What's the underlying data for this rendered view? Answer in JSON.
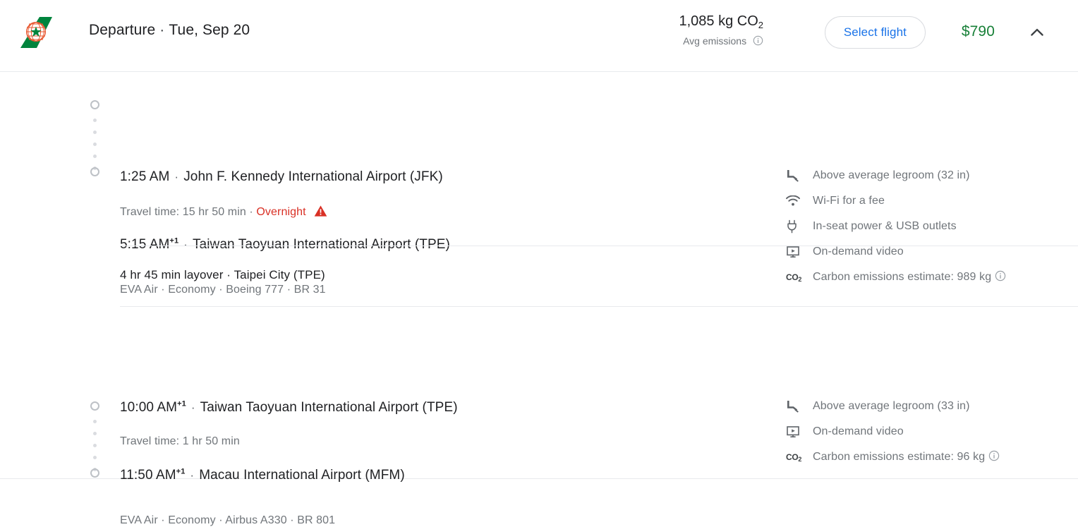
{
  "header": {
    "airline_logo": "eva-air-tail-logo",
    "direction": "Departure",
    "separator": "·",
    "date": "Tue, Sep 20",
    "emissions_value": "1,085 kg CO",
    "emissions_subscript": "2",
    "emissions_label": "Avg emissions",
    "emissions_info_icon": "info-icon",
    "select_flight_label": "Select flight",
    "price": "$790",
    "collapse_icon": "chevron-up-icon"
  },
  "segments": [
    {
      "depart_time": "1:25 AM",
      "depart_day_offset": "",
      "depart_sep": "·",
      "depart_airport": "John F. Kennedy International Airport (JFK)",
      "travel_time": "Travel time: 15 hr 50 min",
      "travel_sep": "·",
      "overnight_label": "Overnight",
      "warning_icon": "warning-triangle-icon",
      "arrive_time": "5:15 AM",
      "arrive_day_offset": "+1",
      "arrive_sep": "·",
      "arrive_airport": "Taiwan Taoyuan International Airport (TPE)",
      "carrier_line": "EVA Air · Economy · Boeing 777 · BR 31",
      "amenities": [
        {
          "icon": "legroom-icon",
          "label": "Above average legroom (32 in)"
        },
        {
          "icon": "wifi-icon",
          "label": "Wi-Fi for a fee"
        },
        {
          "icon": "power-plug-icon",
          "label": "In-seat power & USB outlets"
        },
        {
          "icon": "video-screen-icon",
          "label": "On-demand video"
        },
        {
          "icon": "co2-icon",
          "label": "Carbon emissions estimate: 989 kg",
          "info_icon": "info-icon"
        }
      ]
    },
    {
      "depart_time": "10:00 AM",
      "depart_day_offset": "+1",
      "depart_sep": "·",
      "depart_airport": "Taiwan Taoyuan International Airport (TPE)",
      "travel_time": "Travel time: 1 hr 50 min",
      "travel_sep": "",
      "overnight_label": "",
      "warning_icon": "",
      "arrive_time": "11:50 AM",
      "arrive_day_offset": "+1",
      "arrive_sep": "·",
      "arrive_airport": "Macau International Airport (MFM)",
      "carrier_line": "EVA Air · Economy · Airbus A330 · BR 801",
      "amenities": [
        {
          "icon": "legroom-icon",
          "label": "Above average legroom (33 in)"
        },
        {
          "icon": "video-screen-icon",
          "label": "On-demand video"
        },
        {
          "icon": "co2-icon",
          "label": "Carbon emissions estimate: 96 kg",
          "info_icon": "info-icon"
        }
      ]
    }
  ],
  "layover": {
    "text": "4 hr 45 min layover · Taipei City (TPE)"
  },
  "colors": {
    "accent_blue": "#1a73e8",
    "price_green": "#188038",
    "warning_red": "#d93025",
    "muted_text": "#70757a",
    "divider": "#e8eaed",
    "logo_green": "#00843d",
    "logo_orange": "#e8552d"
  }
}
